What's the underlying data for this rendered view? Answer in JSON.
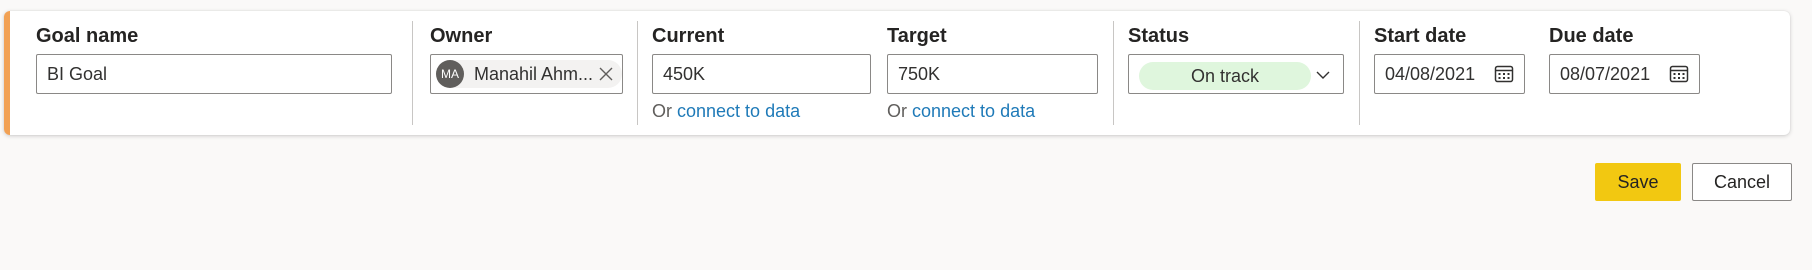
{
  "colors": {
    "accent": "#f2a154",
    "link": "#1f7ab8",
    "status_on_track_bg": "#dff6dd",
    "save_button_bg": "#f2c811"
  },
  "goal_name": {
    "label": "Goal name",
    "value": "BI Goal"
  },
  "owner": {
    "label": "Owner",
    "initials": "MA",
    "name": "Manahil Ahm..."
  },
  "current": {
    "label": "Current",
    "value": "450K",
    "or_text": "Or",
    "link_text": "connect to data"
  },
  "target": {
    "label": "Target",
    "value": "750K",
    "or_text": "Or",
    "link_text": "connect to data"
  },
  "status": {
    "label": "Status",
    "value": "On track"
  },
  "start_date": {
    "label": "Start date",
    "value": "04/08/2021"
  },
  "due_date": {
    "label": "Due date",
    "value": "08/07/2021"
  },
  "actions": {
    "save_label": "Save",
    "cancel_label": "Cancel"
  },
  "icons": [
    "close-icon",
    "chevron-down-icon",
    "calendar-icon"
  ]
}
